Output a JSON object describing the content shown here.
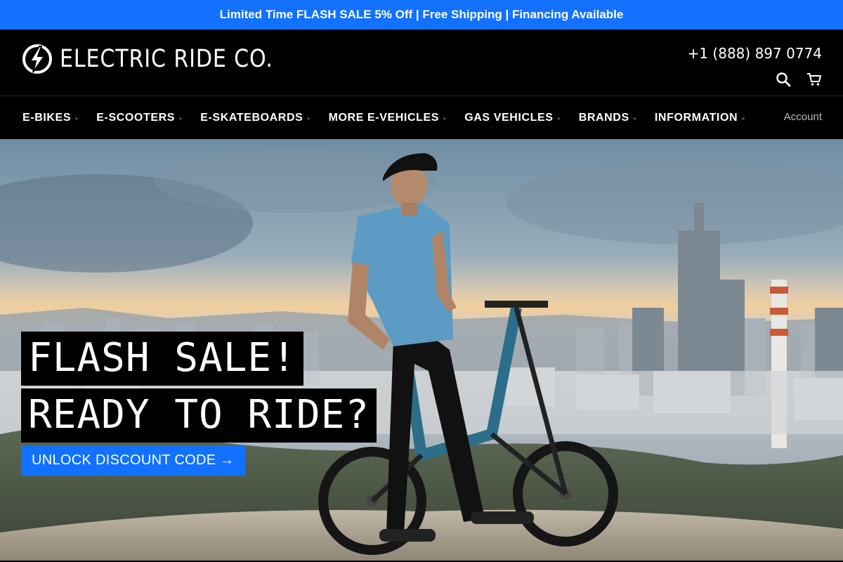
{
  "announcement": {
    "text": "Limited Time FLASH SALE 5% Off | Free Shipping | Financing Available"
  },
  "header": {
    "logo_text": "ELECTRIC RIDE CO.",
    "phone": "+1 (888) 897 0774",
    "icons": [
      "search-icon",
      "cart-icon"
    ]
  },
  "nav": {
    "items": [
      {
        "label": "E-BIKES"
      },
      {
        "label": "E-SCOOTERS"
      },
      {
        "label": "E-SKATEBOARDS"
      },
      {
        "label": "MORE E-VEHICLES"
      },
      {
        "label": "GAS VEHICLES"
      },
      {
        "label": "BRANDS"
      },
      {
        "label": "INFORMATION"
      }
    ],
    "account_label": "Account"
  },
  "hero": {
    "headline_1": "FLASH SALE!",
    "headline_2": "READY TO RIDE?",
    "cta_label": "UNLOCK DISCOUNT CODE →"
  },
  "colors": {
    "announcement_bg": "#1271ff",
    "header_bg": "#000000",
    "cta_bg": "#1271ff"
  }
}
